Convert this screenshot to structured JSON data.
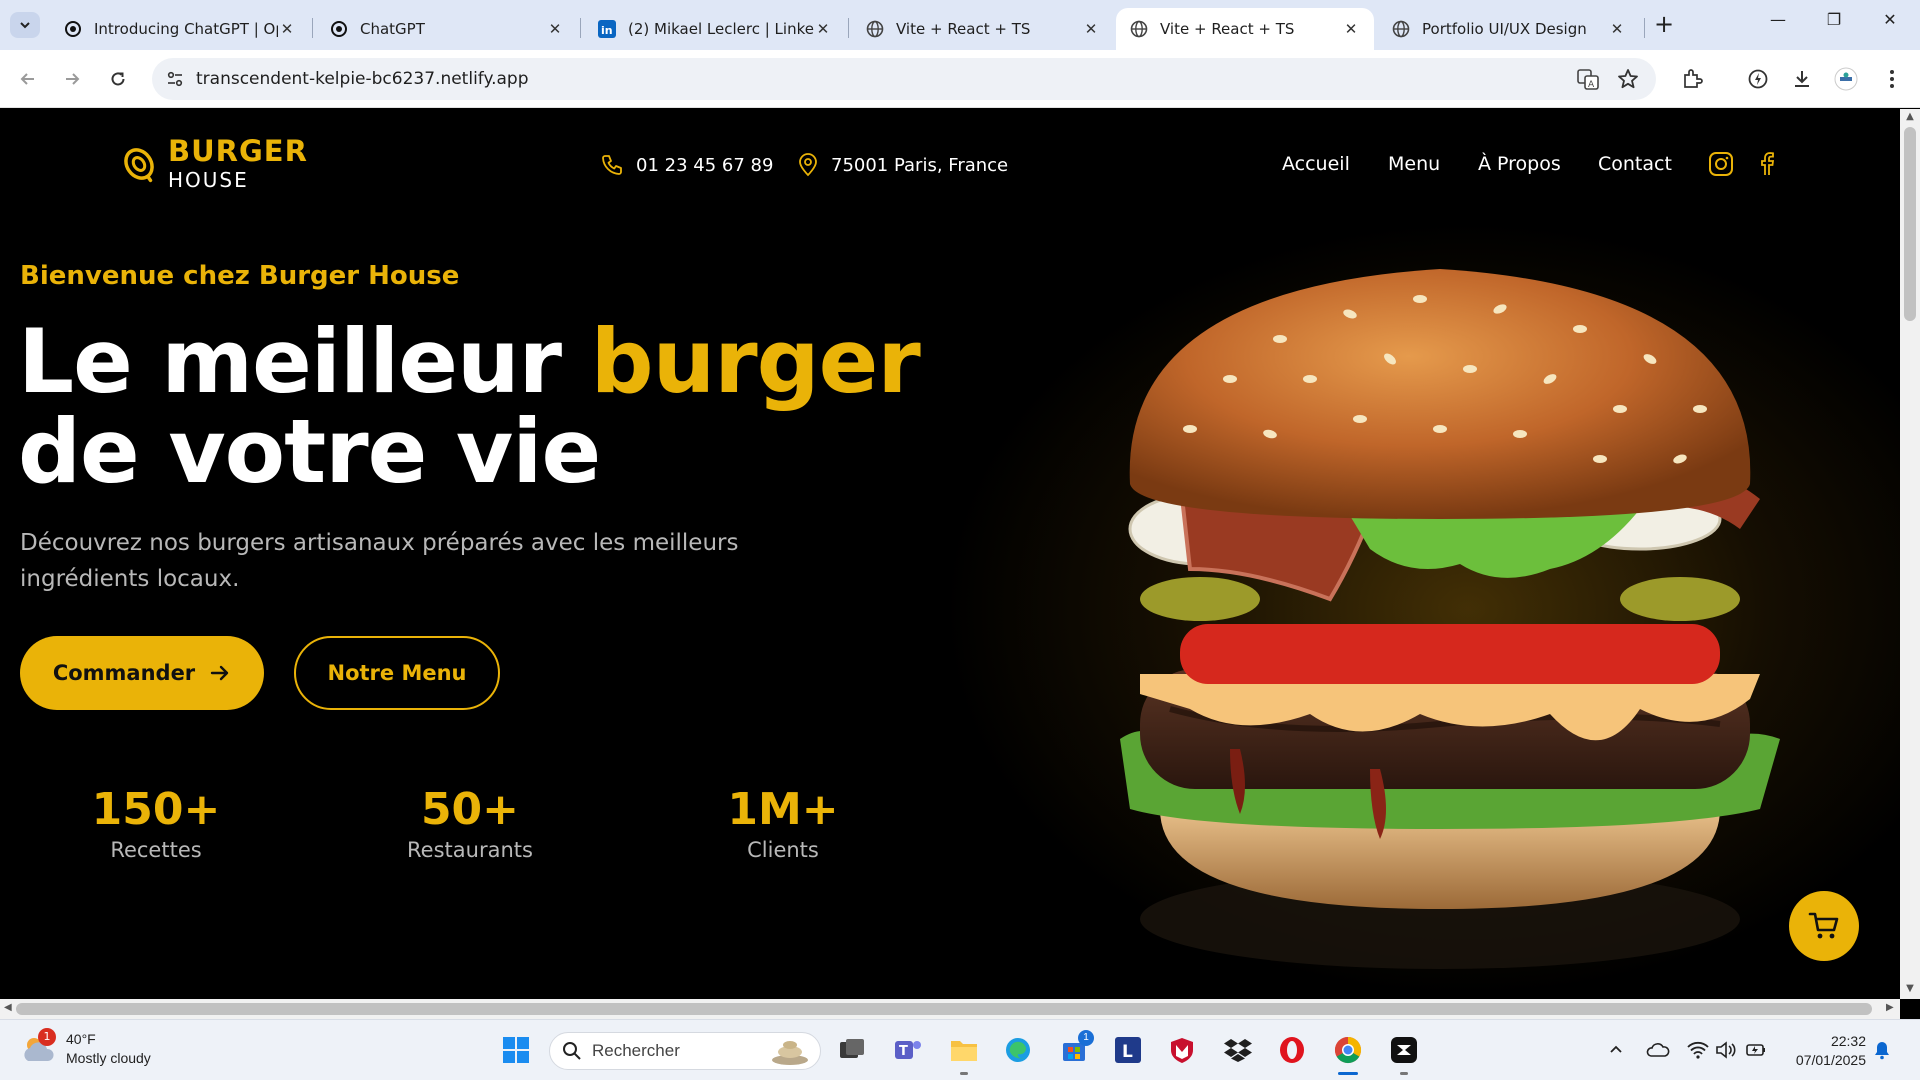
{
  "browser": {
    "tabs": [
      {
        "title": "Introducing ChatGPT | Ope",
        "favicon": "openai-icon"
      },
      {
        "title": "ChatGPT",
        "favicon": "openai-icon"
      },
      {
        "title": "(2) Mikael Leclerc | LinkedIn",
        "favicon": "linkedin-icon"
      },
      {
        "title": "Vite + React + TS",
        "favicon": "globe-icon"
      },
      {
        "title": "Vite + React + TS",
        "favicon": "globe-icon",
        "active": true
      },
      {
        "title": "Portfolio UI/UX Design",
        "favicon": "globe-icon"
      }
    ],
    "url": "transcendent-kelpie-bc6237.netlify.app"
  },
  "site": {
    "brand": {
      "line1": "BURGER",
      "line2": "HOUSE"
    },
    "phone": "01 23 45 67 89",
    "address": "75001 Paris, France",
    "nav": [
      "Accueil",
      "Menu",
      "À Propos",
      "Contact"
    ],
    "hero": {
      "welcome": "Bienvenue chez Burger House",
      "headline_part1": "Le meilleur ",
      "headline_accent": "burger",
      "headline_part2": "de votre vie",
      "subtitle": "Découvrez nos burgers artisanaux préparés avec les meilleurs ingrédients locaux.",
      "cta_primary": "Commander",
      "cta_secondary": "Notre Menu"
    },
    "stats": [
      {
        "value": "150+",
        "label": "Recettes"
      },
      {
        "value": "50+",
        "label": "Restaurants"
      },
      {
        "value": "1M+",
        "label": "Clients"
      }
    ],
    "colors": {
      "accent": "#eab308",
      "background": "#000000"
    }
  },
  "taskbar": {
    "weather": {
      "temp": "40°F",
      "condition": "Mostly cloudy",
      "badge": "1"
    },
    "search_placeholder": "Rechercher",
    "store_badge": "1",
    "time": "22:32",
    "date": "07/01/2025"
  }
}
